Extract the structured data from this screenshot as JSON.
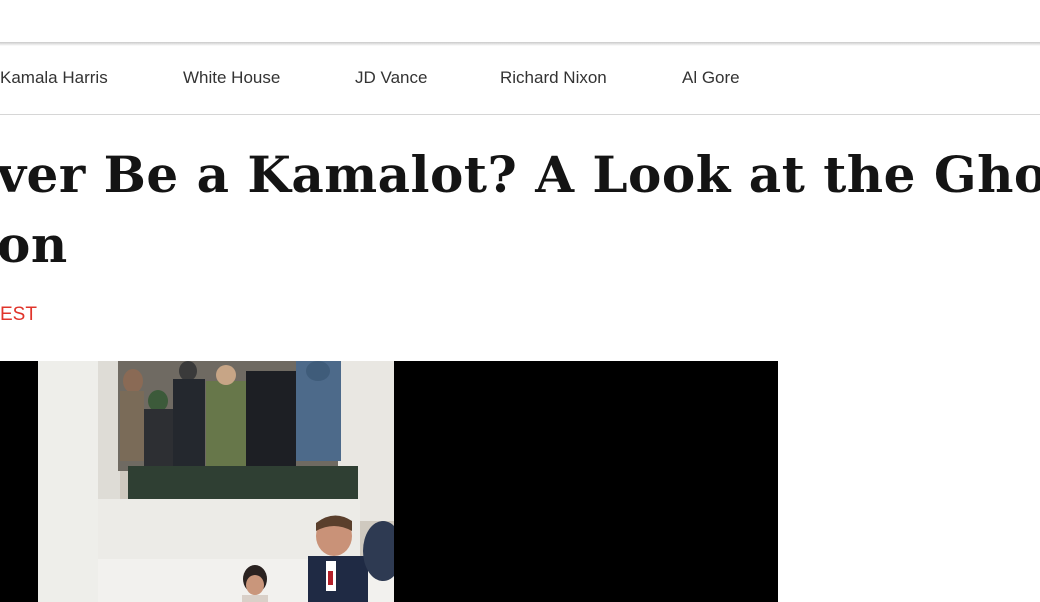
{
  "nav": {
    "topics": [
      {
        "label": "Kamala Harris"
      },
      {
        "label": "White House"
      },
      {
        "label": "JD Vance"
      },
      {
        "label": "Richard Nixon"
      },
      {
        "label": "Al Gore"
      }
    ]
  },
  "article": {
    "headline_line1": "ver Be a Kamalot? A Look at the Ghost",
    "headline_line2": "on",
    "dateline": "EST"
  },
  "colors": {
    "accent": "#e0342b",
    "headline": "#141414",
    "nav_text": "#333333",
    "divider": "#d6d6d6"
  },
  "video": {
    "thumbnail_icon": "video-thumbnail-white-house-arrival"
  }
}
